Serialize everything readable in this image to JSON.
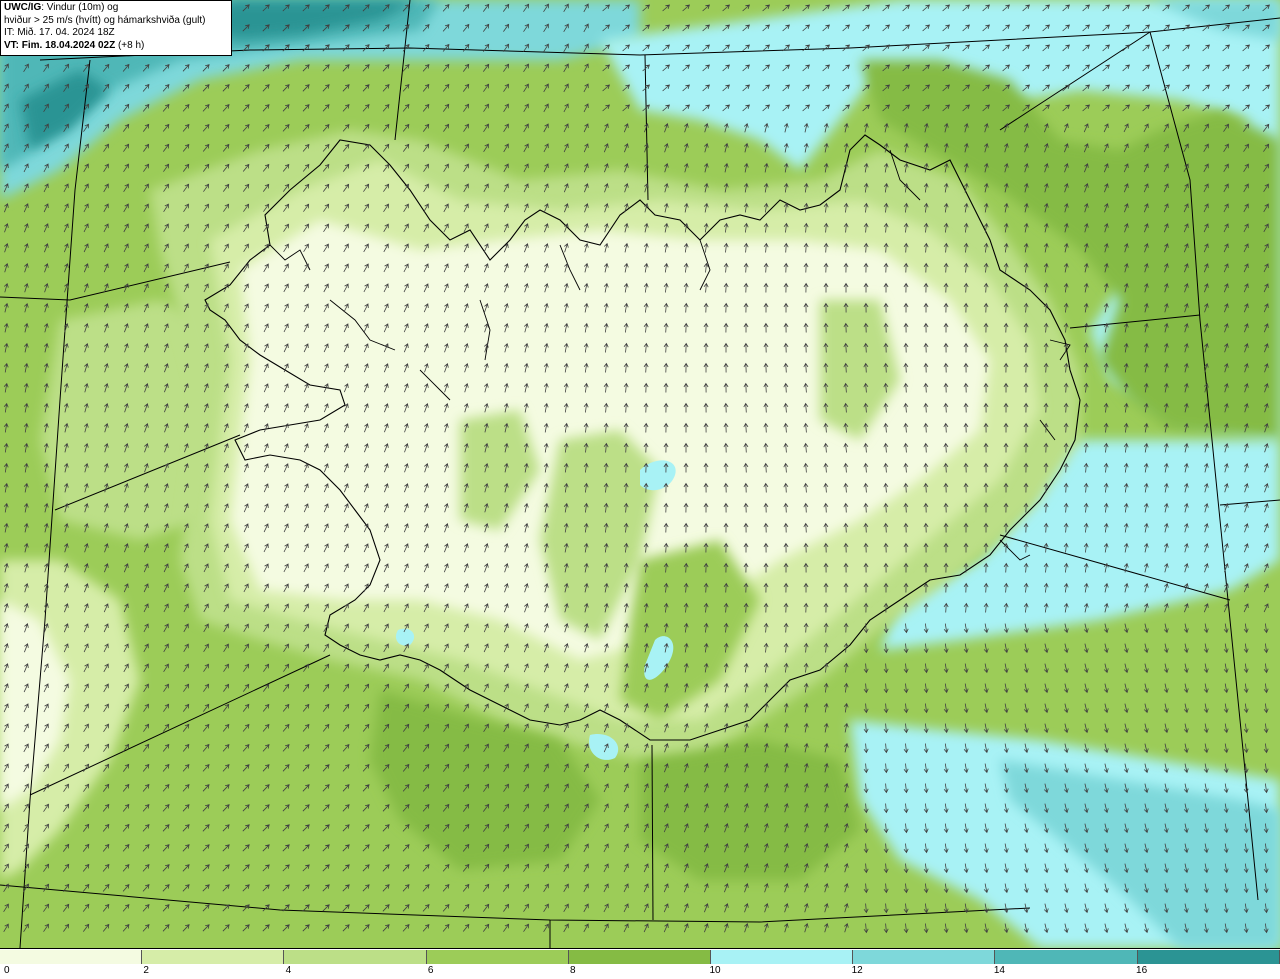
{
  "info": {
    "model": "UWC/IG",
    "line1_rest": ": Vindur (10m) og",
    "line2": "hviður > 25 m/s (hvítt) og hámarkshviða (gult)",
    "line3": "IT: Mið. 17. 04. 2024 18Z",
    "line4_label": "VT: Fim. 18.04.2024 02Z",
    "line4_rest": " (+8 h)"
  },
  "legend": {
    "ticks": [
      "0",
      "2",
      "4",
      "6",
      "8",
      "10",
      "12",
      "14",
      "16"
    ],
    "colors": [
      "#f4fbe1",
      "#d6eda8",
      "#bcdf87",
      "#9ccc58",
      "#85bb44",
      "#a8f2f5",
      "#7ed8da",
      "#4fb7b7",
      "#2b9494",
      "#c8b4ee"
    ]
  },
  "map": {
    "colors": {
      "sea_mid": "#9ccc58",
      "calm": "#f4fbe1",
      "light": "#d6eda8",
      "moderate": "#bcdf87",
      "strong": "#85bb44",
      "cyan_light": "#a8f2f5",
      "cyan_mid": "#7ed8da",
      "teal": "#4fb7b7",
      "teal_dark": "#2b9494",
      "arrow": "#404040",
      "coast": "#000000"
    },
    "wind_direction_deg": 200
  }
}
